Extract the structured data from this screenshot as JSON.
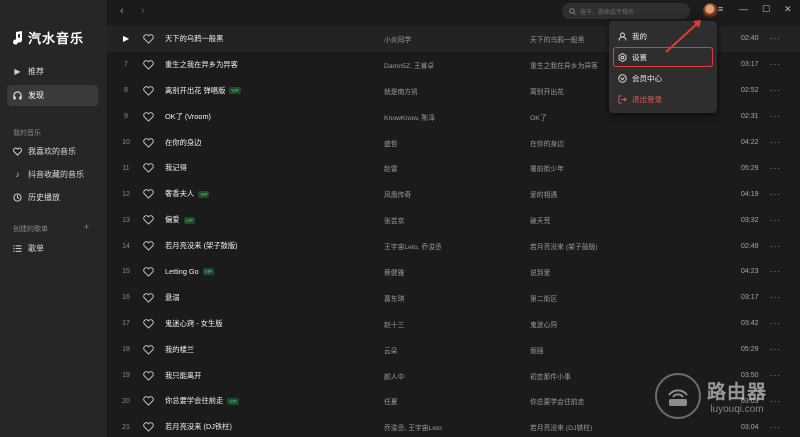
{
  "app": {
    "name": "汽水音乐",
    "accent_color": "#e03b3b"
  },
  "sidebar": {
    "nav": [
      {
        "label": "推荐",
        "icon": "play-icon"
      },
      {
        "label": "发现",
        "icon": "headphones-icon",
        "active": true
      }
    ],
    "my_music_title": "我的音乐",
    "my_music": [
      {
        "label": "我喜欢的音乐",
        "icon": "heart-icon"
      },
      {
        "label": "抖音收藏的音乐",
        "icon": "tiktok-icon"
      },
      {
        "label": "历史播放",
        "icon": "history-icon"
      }
    ],
    "playlists_title": "创建的歌单",
    "add_label": "+",
    "playlists": [
      {
        "label": "歌单",
        "icon": "list-icon"
      }
    ]
  },
  "topbar": {
    "back": "‹",
    "forward": "›",
    "search_placeholder": "搜干、歌曲或专辑名"
  },
  "window_controls": {
    "menu": "≡",
    "minimize": "—",
    "maximize": "☐",
    "close": "✕"
  },
  "dropdown": {
    "items": [
      {
        "label": "我的",
        "icon": "user-icon"
      },
      {
        "label": "设置",
        "icon": "gear-icon",
        "highlighted": true
      },
      {
        "label": "会员中心",
        "icon": "vip-center-icon"
      },
      {
        "label": "退出登录",
        "icon": "logout-icon",
        "color": "#e03b3b"
      }
    ]
  },
  "songs": [
    {
      "index": "",
      "playing": true,
      "title": "天下的乌鸦一般黑",
      "vip": false,
      "artist": "小炎同学",
      "album": "天下的乌鸦一般黑",
      "duration": "02:40"
    },
    {
      "index": "7",
      "title": "重生之我在异乡为异客",
      "vip": false,
      "artist": "Damn5Z, 王睿卓",
      "album": "重生之我在异乡为异客",
      "duration": "03:17"
    },
    {
      "index": "8",
      "title": "离别开出花 弹唱版",
      "vip": true,
      "artist": "就是南方凯",
      "album": "离别开出花",
      "duration": "02:52"
    },
    {
      "index": "9",
      "title": "OK了 (Vroom)",
      "vip": false,
      "artist": "KnowKnow, 陈泽",
      "album": "OK了",
      "duration": "02:31"
    },
    {
      "index": "10",
      "title": "在你的身边",
      "vip": false,
      "artist": "盛哲",
      "album": "在你的身边",
      "duration": "04:22"
    },
    {
      "index": "11",
      "title": "我记得",
      "vip": false,
      "artist": "赵雷",
      "album": "署前街少年",
      "duration": "05:29"
    },
    {
      "index": "12",
      "title": "奢香夫人",
      "vip": true,
      "artist": "凤凰传奇",
      "album": "爱的相遇",
      "duration": "04:19"
    },
    {
      "index": "13",
      "title": "偏爱",
      "vip": true,
      "artist": "张芸京",
      "album": "破天荒",
      "duration": "03:32"
    },
    {
      "index": "14",
      "title": "若月亮没来 (架子鼓版)",
      "vip": false,
      "artist": "王宇宙Leto, 乔浚丞",
      "album": "若月亮没来 (架子鼓版)",
      "duration": "02:49"
    },
    {
      "index": "15",
      "title": "Letting Go",
      "vip": true,
      "artist": "蔡健雅",
      "album": "说到爱",
      "duration": "04:23"
    },
    {
      "index": "16",
      "title": "悬溺",
      "vip": false,
      "artist": "葛东琪",
      "album": "第二街区",
      "duration": "03:17"
    },
    {
      "index": "17",
      "title": "鬼迷心窍 - 女生版",
      "vip": false,
      "artist": "赵十三",
      "album": "鬼迷心窍",
      "duration": "03:42"
    },
    {
      "index": "18",
      "title": "我的楼兰",
      "vip": false,
      "artist": "云朵",
      "album": "倔强",
      "duration": "05:29"
    },
    {
      "index": "19",
      "title": "我只能离开",
      "vip": false,
      "artist": "颜人中",
      "album": "初恋那件小事",
      "duration": "03:50"
    },
    {
      "index": "20",
      "title": "你总要学会往前走",
      "vip": true,
      "artist": "任夏",
      "album": "你总要学会往前走",
      "duration": "03:03"
    },
    {
      "index": "21",
      "title": "若月亮没来 (DJ铁柱)",
      "vip": false,
      "artist": "乔浚丞, 王宇宙Leto",
      "album": "若月亮没来 (DJ铁柱)",
      "duration": "03:04"
    }
  ],
  "row_more_label": "···",
  "vip_badge": "VIP",
  "watermark": {
    "main": "路由器",
    "sub": "luyouqi.com"
  }
}
